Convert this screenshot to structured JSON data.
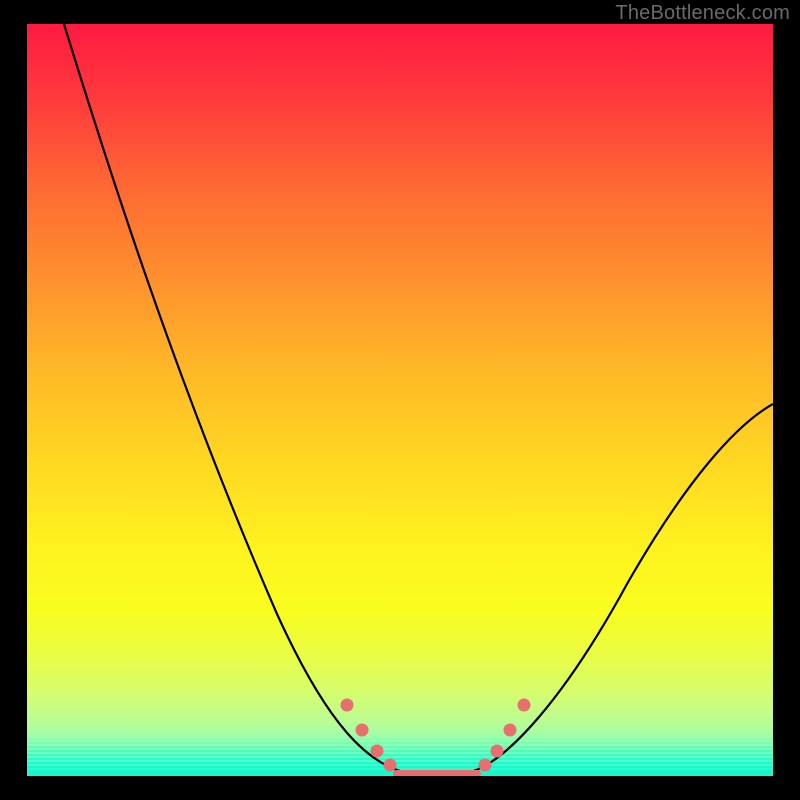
{
  "watermark": {
    "text": "TheBottleneck.com"
  },
  "chart_data": {
    "type": "line",
    "title": "",
    "xlabel": "",
    "ylabel": "",
    "xlim": [
      0,
      100
    ],
    "ylim": [
      0,
      100
    ],
    "grid": false,
    "series": [
      {
        "name": "left-curve",
        "x": [
          5,
          8,
          12,
          16,
          20,
          24,
          28,
          32,
          36,
          40,
          43,
          46,
          49,
          51
        ],
        "y": [
          100,
          92,
          81,
          70,
          60,
          50,
          41,
          32,
          24,
          16,
          10,
          5,
          2,
          0.3
        ]
      },
      {
        "name": "right-curve",
        "x": [
          59,
          62,
          66,
          70,
          74,
          79,
          84,
          90,
          96,
          100
        ],
        "y": [
          0.3,
          2,
          5,
          9,
          14,
          20,
          27,
          35,
          43,
          49
        ]
      },
      {
        "name": "trough-flat",
        "x": [
          49,
          51,
          54,
          57,
          59
        ],
        "y": [
          0.3,
          0.1,
          0.1,
          0.1,
          0.3
        ]
      }
    ],
    "markers": {
      "name": "valley-dots",
      "color": "#e76f6f",
      "points": [
        {
          "x": 42.5,
          "y": 9.5
        },
        {
          "x": 44.5,
          "y": 6.0
        },
        {
          "x": 46.5,
          "y": 3.0
        },
        {
          "x": 48.5,
          "y": 1.2
        },
        {
          "x": 51.0,
          "y": 0.4
        },
        {
          "x": 53.5,
          "y": 0.3
        },
        {
          "x": 56.0,
          "y": 0.4
        },
        {
          "x": 58.5,
          "y": 1.2
        },
        {
          "x": 60.5,
          "y": 3.0
        },
        {
          "x": 62.5,
          "y": 6.0
        },
        {
          "x": 64.5,
          "y": 9.5
        }
      ]
    },
    "trough_bar": {
      "name": "valley-underline",
      "color": "#e76f6f",
      "x_start": 49,
      "x_end": 59,
      "y": 0.15
    },
    "background_gradient": {
      "top": "#ff1a42",
      "mid": "#ffd722",
      "bottom": "#17f9cc"
    }
  }
}
